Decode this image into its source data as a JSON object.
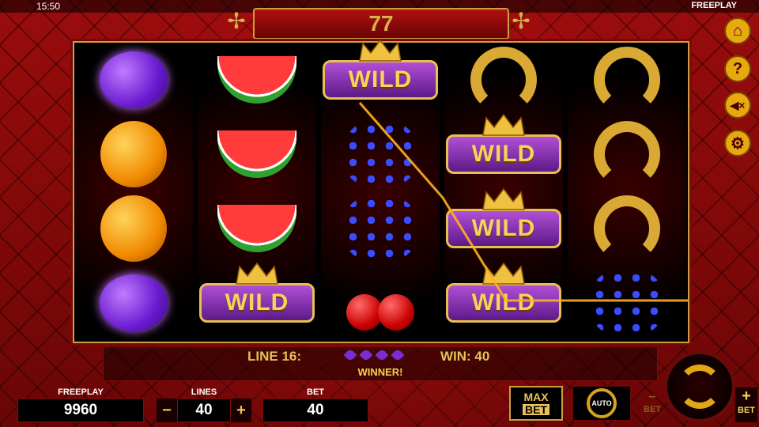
{
  "clock": "15:50",
  "mode": "FREEPLAY",
  "title": "77",
  "payline": {
    "line_text": "LINE 16:",
    "win_text": "WIN: 40",
    "message": "WINNER!"
  },
  "panel": {
    "credit_label": "FREEPLAY",
    "credit_value": "9960",
    "lines_label": "LINES",
    "lines_value": "40",
    "minus": "−",
    "plus": "+",
    "bet_label": "BET",
    "bet_value": "40"
  },
  "buttons": {
    "max": "MAX",
    "bet": "BET",
    "auto": "AUTO",
    "bet_minus": "BET",
    "bet_plus": "BET"
  },
  "wild_text": "WILD",
  "reels": [
    [
      "plum",
      "orange",
      "orange",
      "plum"
    ],
    [
      "melon",
      "melon",
      "melon",
      "wild"
    ],
    [
      "wild",
      "grape",
      "grape",
      "cherry"
    ],
    [
      "horseshoe",
      "wild",
      "wild",
      "wild"
    ],
    [
      "horseshoe",
      "horseshoe",
      "horseshoe",
      "grape"
    ]
  ],
  "side_icons": [
    "home-icon",
    "help-icon",
    "sound-off-icon",
    "settings-icon"
  ],
  "colors": {
    "gold": "#e4c254",
    "felt": "#9a0c0c",
    "wild_purple": "#7a2dd2"
  }
}
